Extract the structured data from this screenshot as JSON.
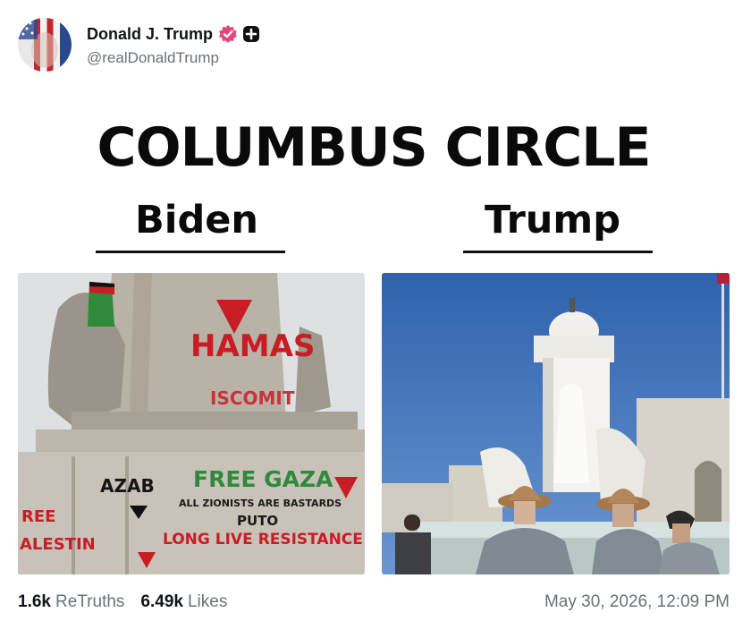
{
  "post": {
    "author_name": "Donald J. Trump",
    "author_handle": "@realDonaldTrump",
    "verified_icon": "verified-badge-icon",
    "plus_icon": "plus-icon",
    "accent_color": "#e2487d",
    "timestamp": "May 30, 2026, 12:09 PM"
  },
  "meme": {
    "title": "COLUMBUS CIRCLE",
    "left_label": "Biden",
    "right_label": "Trump",
    "left_graffiti": {
      "hamas": "HAMAS",
      "iscommit": "ISCOMIT",
      "azab": "AZAB",
      "free_gaza": "FREE GAZA",
      "zionists": "ALL ZIONISTS ARE BASTARDS",
      "puto": "PUTO",
      "resistance": "LONG LIVE RESISTANCE",
      "free_palestine_top": "REE",
      "free_palestine_bottom": "ALESTIN"
    }
  },
  "stats": {
    "retruths_count": "1.6k",
    "retruths_label": "ReTruths",
    "likes_count": "6.49k",
    "likes_label": "Likes"
  }
}
